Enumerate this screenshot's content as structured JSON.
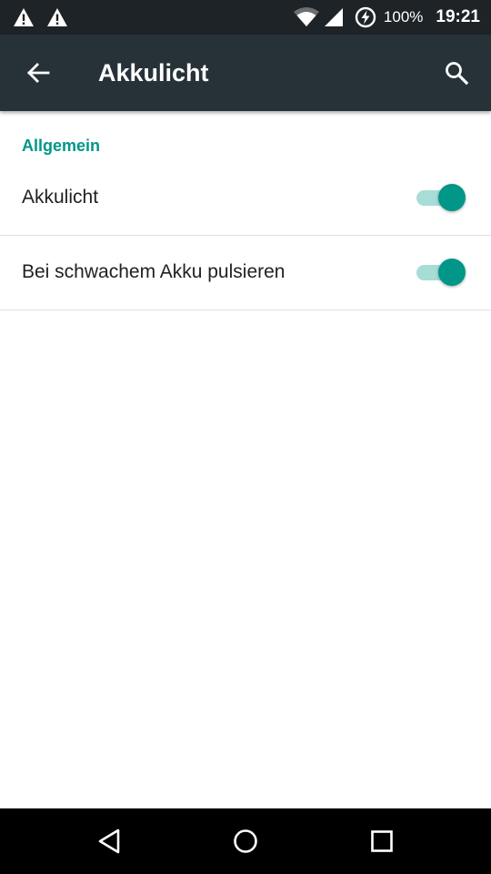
{
  "status_bar": {
    "left_icons": [
      "warning-icon",
      "warning-icon"
    ],
    "right_icons": [
      "wifi-icon",
      "cell-signal-icon",
      "battery-charging-icon"
    ],
    "battery": "100%",
    "time": "19:21"
  },
  "app_bar": {
    "title": "Akkulicht",
    "back_icon": "arrow-back-icon",
    "search_icon": "search-icon"
  },
  "section": {
    "header": "Allgemein"
  },
  "preferences": [
    {
      "label": "Akkulicht",
      "enabled": true
    },
    {
      "label": "Bei schwachem Akku pulsieren",
      "enabled": true
    }
  ],
  "nav_bar": {
    "icons": [
      "back-triangle-icon",
      "home-circle-icon",
      "recents-square-icon"
    ]
  },
  "colors": {
    "status_bar": "#1e2327",
    "app_bar": "#263238",
    "accent": "#009688",
    "toggle_track": "#a8dcd6",
    "nav_bar": "#000000"
  }
}
